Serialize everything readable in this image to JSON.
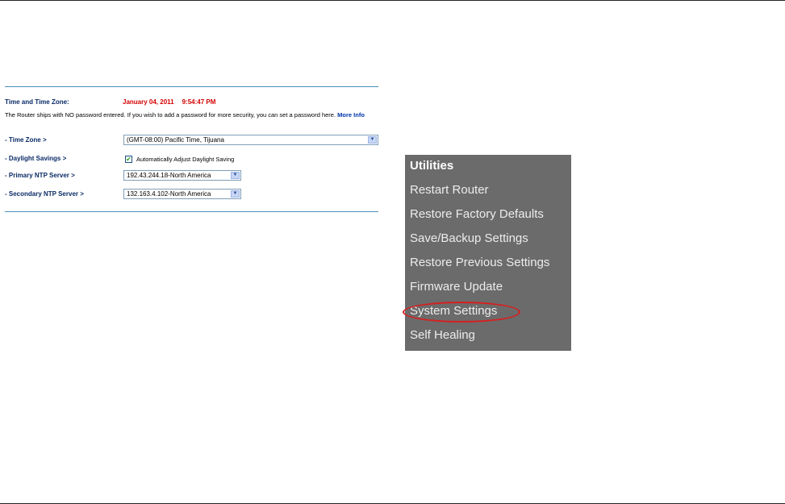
{
  "time_settings": {
    "heading": "Time and Time Zone:",
    "date": "January 04, 2011",
    "time": "9:54:47 PM",
    "note": "The Router ships with NO password entered. If you wish to add a password for more security, you can set a password here.",
    "more_info": "More Info",
    "time_zone_label": "- Time Zone >",
    "time_zone_value": "(GMT-08:00) Pacific Time, Tijuana",
    "daylight_label": "- Daylight Savings >",
    "daylight_checkbox_label": "Automatically Adjust Daylight Saving",
    "daylight_checked": true,
    "primary_ntp_label": "- Primary NTP Server >",
    "primary_ntp_value": "192.43.244.18-North America",
    "secondary_ntp_label": "- Secondary NTP Server >",
    "secondary_ntp_value": "132.163.4.102-North America"
  },
  "utilities_menu": {
    "title": "Utilities",
    "items": [
      {
        "label": "Restart Router"
      },
      {
        "label": "Restore Factory Defaults"
      },
      {
        "label": "Save/Backup Settings"
      },
      {
        "label": "Restore Previous Settings"
      },
      {
        "label": "Firmware Update"
      },
      {
        "label": "System Settings",
        "highlighted": true
      },
      {
        "label": "Self Healing"
      }
    ],
    "highlight_color": "#d62020"
  },
  "icons": {
    "select_arrow": "chevron-down-icon",
    "checkbox_mark": "checkmark-icon"
  }
}
